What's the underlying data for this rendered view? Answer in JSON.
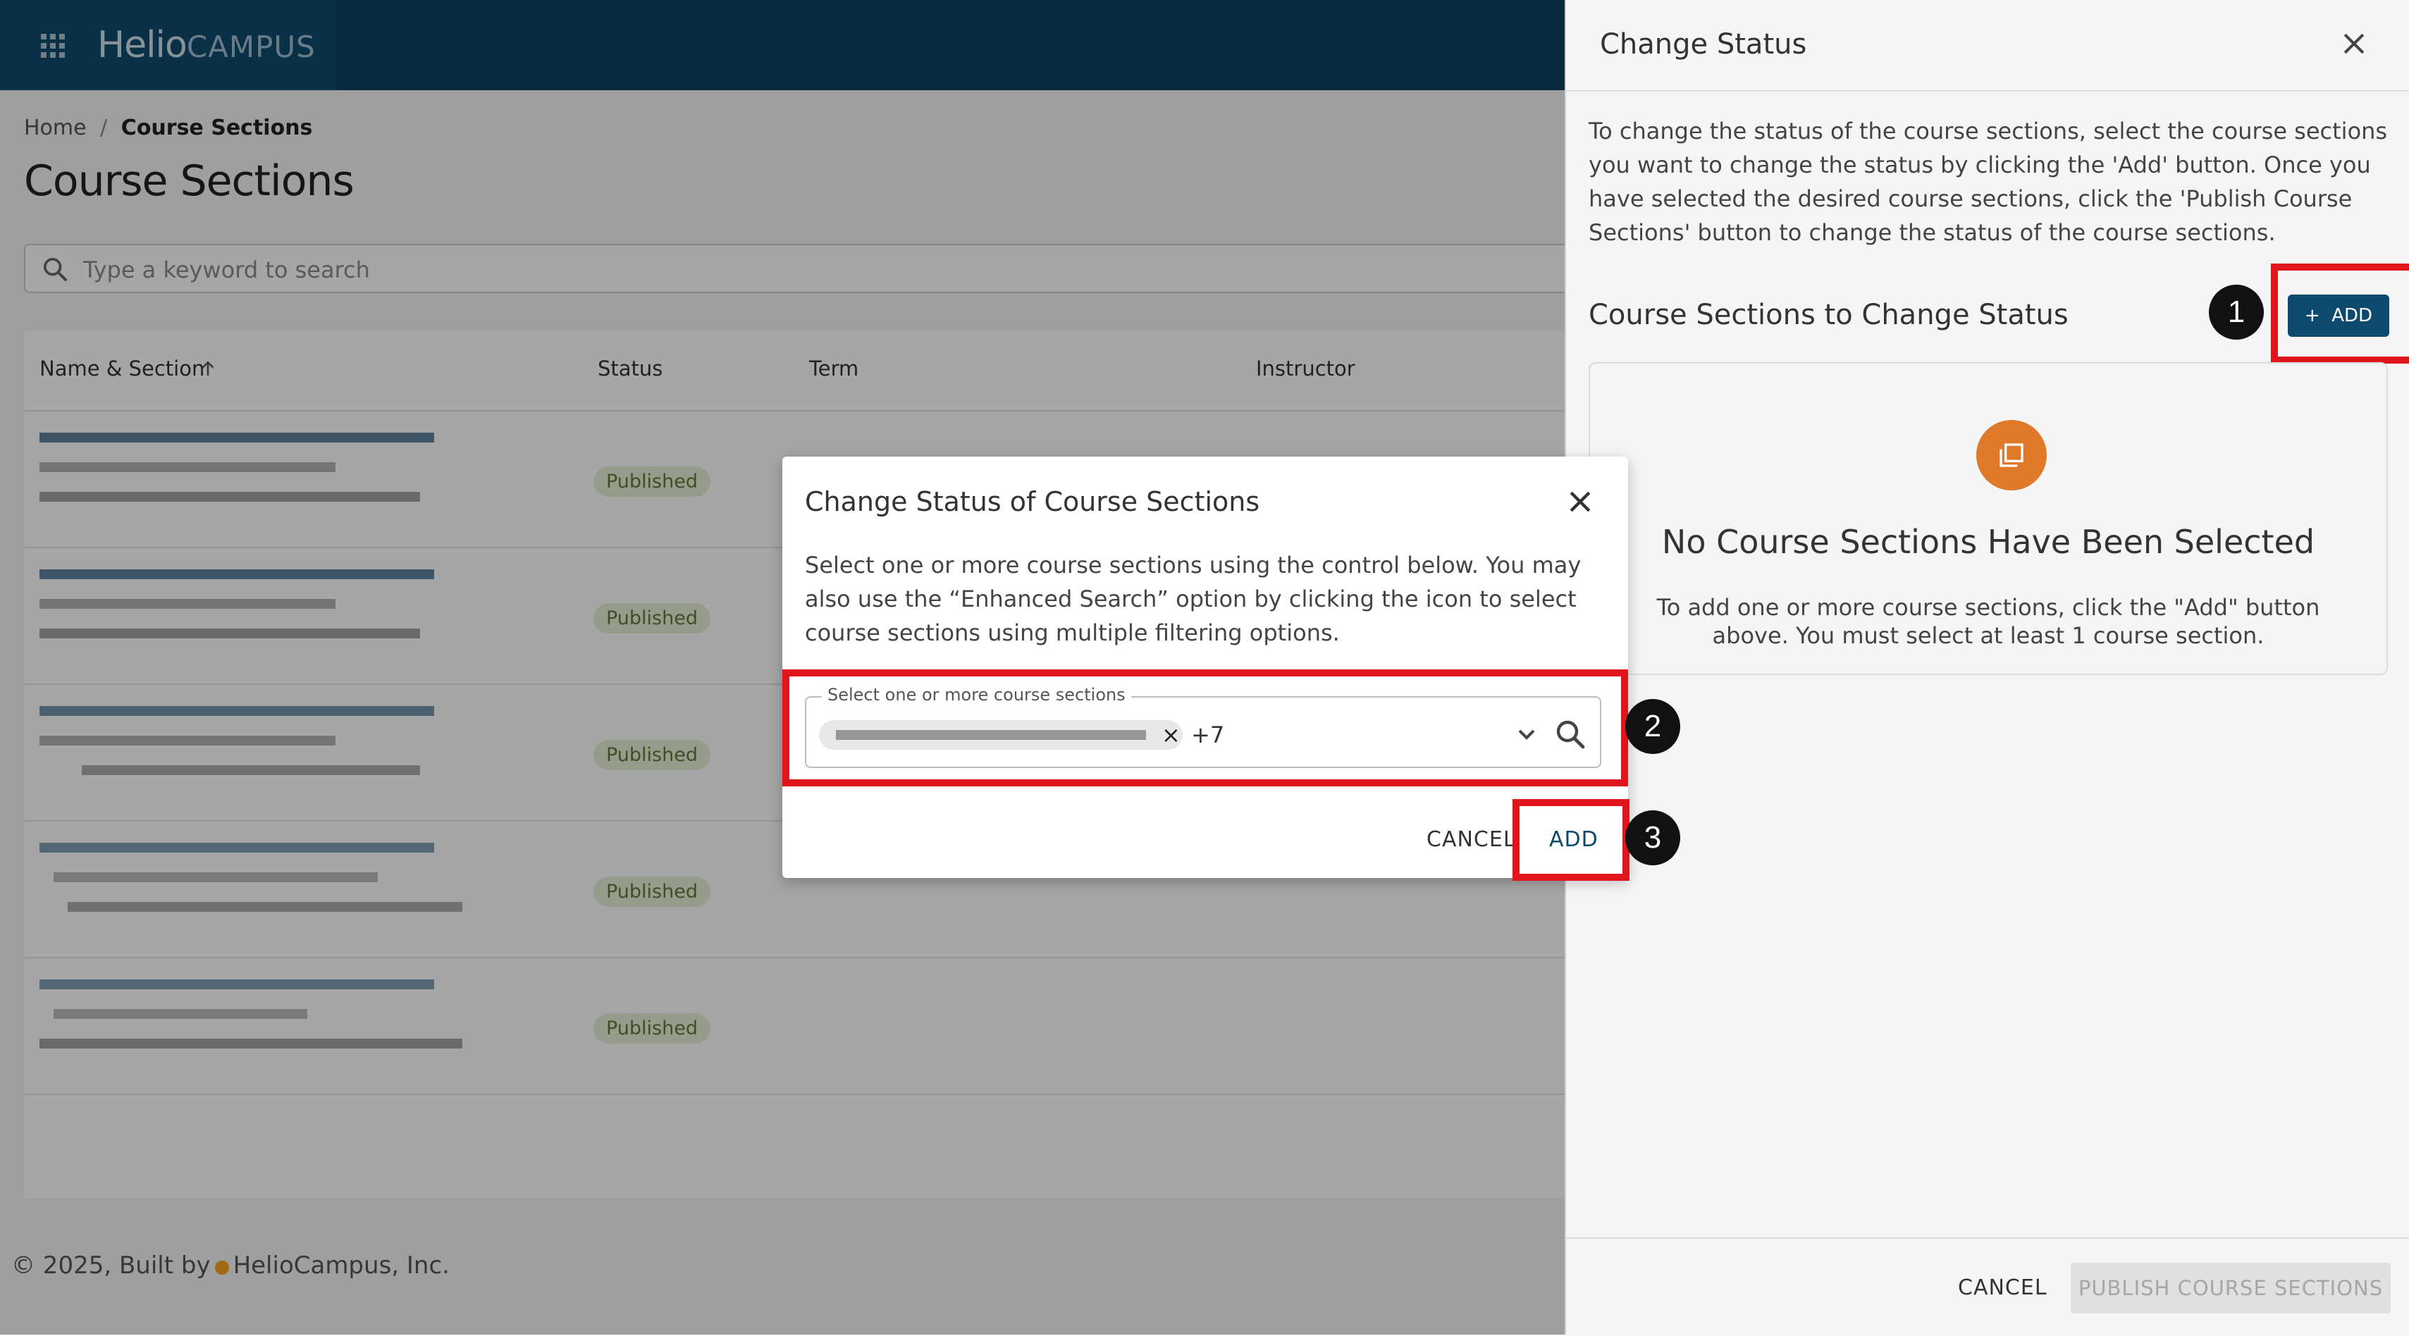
{
  "app": {
    "brand_main": "Helio",
    "brand_sub": "CAMPUS"
  },
  "breadcrumb": {
    "home": "Home",
    "separator": "/",
    "current": "Course Sections"
  },
  "page_title": "Course Sections",
  "search": {
    "placeholder": "Type a keyword to search"
  },
  "table": {
    "columns": [
      "Name & Section",
      "Status",
      "Term",
      "Instructor"
    ],
    "rows": [
      {
        "status": "Published"
      },
      {
        "status": "Published"
      },
      {
        "status": "Published"
      },
      {
        "status": "Published"
      },
      {
        "status": "Published"
      }
    ]
  },
  "footer": {
    "prefix": "© 2025, Built by",
    "company": "HelioCampus, Inc."
  },
  "panel": {
    "title": "Change Status",
    "intro": "To change the status of the course sections, select the course sections you want to change the status by clicking the 'Add' button. Once you have selected the desired course sections, click the 'Publish Course Sections' button to change the status of the course sections.",
    "section_title": "Course Sections to Change Status",
    "add_label": "ADD",
    "empty_title": "No Course Sections Have Been Selected",
    "empty_sub": "To add one or more course sections, click the \"Add\" button above. You must select at least 1 course section.",
    "cancel_label": "CANCEL",
    "publish_label": "PUBLISH COURSE SECTIONS"
  },
  "modal": {
    "title": "Change Status of Course Sections",
    "description": "Select one or more course sections using the control below. You may also use the “Enhanced Search” option by clicking the icon to select course sections using multiple filtering options.",
    "field_label": "Select one or more course sections",
    "more_count": "+7",
    "cancel_label": "CANCEL",
    "add_label": "ADD"
  },
  "annotations": [
    "1",
    "2",
    "3"
  ],
  "colors": {
    "primary": "#0d4a6d",
    "highlight": "#e0141b",
    "badge_bg": "#e6f0d6",
    "empty_icon": "#e1792b"
  }
}
